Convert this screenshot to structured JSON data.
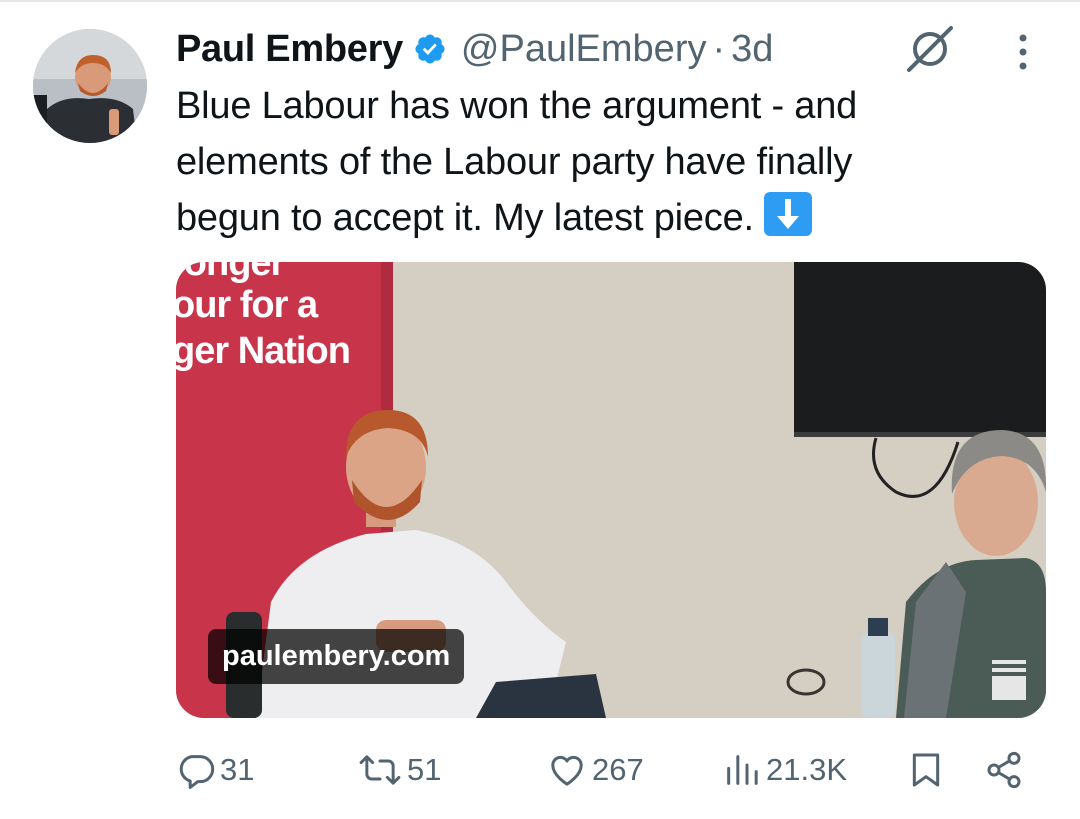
{
  "tweet": {
    "author": {
      "display_name": "Paul Embery",
      "handle": "@PaulEmbery",
      "verified": true,
      "avatar_icon": "avatar-photo"
    },
    "separator": "·",
    "age": "3d",
    "text_lines": [
      "Blue Labour has won the argument - and",
      "elements of the Labour party have finally",
      "begun to accept it. My latest piece."
    ],
    "emoji_icon": "down-arrow-emoji",
    "media": {
      "banner_lines": [
        "ronger",
        "our for a",
        "ger Nation"
      ],
      "link_domain": "paulembery.com"
    },
    "actions": {
      "replies": "31",
      "reposts": "51",
      "likes": "267",
      "views": "21.3K"
    }
  },
  "colors": {
    "verified_blue": "#1d9bf0",
    "secondary_text": "#536471",
    "banner_red": "#c8344a"
  }
}
